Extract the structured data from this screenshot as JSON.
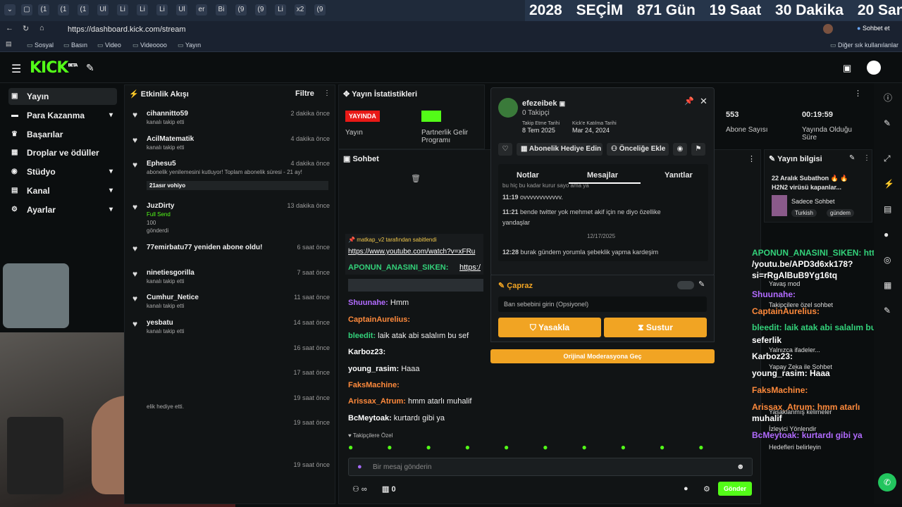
{
  "browser": {
    "url": "https://dashboard.kick.com/stream",
    "tab_labels": [
      "(1",
      "(1",
      "(1",
      "Ul",
      "Li",
      "Li",
      "Li",
      "Ul",
      "er",
      "Bi",
      "(9",
      "(9",
      "Li",
      "x2",
      "(9"
    ],
    "countdown": {
      "year": "2028",
      "election": "SEÇİM",
      "days": "871 Gün",
      "hours": "19 Saat",
      "minutes": "30 Dakika",
      "seconds": "20 Saniye"
    },
    "chat_button": "Sohbet et",
    "bookmarks": [
      "Sosyal",
      "Basın",
      "Video",
      "Videoooo",
      "Yayın"
    ],
    "other_bookmarks": "Diğer sık kullanılanlar"
  },
  "logo": "KICK",
  "logo_sup": "BETA",
  "sidebar": {
    "items": [
      {
        "label": "Yayın",
        "icon": "video-icon"
      },
      {
        "label": "Para Kazanma",
        "icon": "money-icon"
      },
      {
        "label": "Başarılar",
        "icon": "trophy-icon"
      },
      {
        "label": "Droplar ve ödüller",
        "icon": "gift-icon"
      },
      {
        "label": "Stüdyo",
        "icon": "studio-icon"
      },
      {
        "label": "Kanal",
        "icon": "channel-icon"
      },
      {
        "label": "Ayarlar",
        "icon": "gear-icon"
      }
    ]
  },
  "activity": {
    "title": "Etkinlik Akışı",
    "filter": "Filtre",
    "items": [
      {
        "name": "cihannitto59",
        "sub": "kanalı takip etti",
        "time": "2 dakika önce"
      },
      {
        "name": "AcilMatematik",
        "sub": "kanalı takip etti",
        "time": "4 dakika önce"
      },
      {
        "name": "Ephesu5",
        "sub": "abonelik yenilemesini kutluyor! Toplam abonelik süresi - 21 ay!",
        "time": "4 dakika önce",
        "extra": "21asır vohiyo"
      },
      {
        "name": "JuzDirty",
        "sub": "Full Send",
        "sub2": "100",
        "sub3": "gönderdi",
        "time": "13 dakika önce"
      },
      {
        "name": "77emirbatu77 yeniden abone oldu!",
        "sub": "",
        "time": "6 saat önce"
      },
      {
        "name": "ninetiesgorilla",
        "sub": "kanalı takip etti",
        "time": "7 saat önce"
      },
      {
        "name": "Cumhur_Netice",
        "sub": "kanalı takip etti",
        "time": "11 saat önce"
      },
      {
        "name": "yesbatu",
        "sub": "kanalı takip etti",
        "time": "14 saat önce"
      },
      {
        "name": "",
        "sub": "",
        "time": "16 saat önce"
      },
      {
        "name": "",
        "sub": "",
        "time": "17 saat önce"
      },
      {
        "name": "",
        "sub": "elik hediye etti.",
        "time": "19 saat önce"
      },
      {
        "name": "",
        "sub": "",
        "time": "19 saat önce"
      },
      {
        "name": "",
        "sub": "",
        "time": "19 saat önce"
      }
    ]
  },
  "stats": {
    "title": "Yayın İstatistikleri",
    "live_badge": "YAYINDA",
    "live_label": "Yayın",
    "partner_label": "Partnerlik Gelir Programı",
    "subs_value": "553",
    "subs_label": "Abone Sayısı",
    "uptime_value": "00:19:59",
    "uptime_label": "Yayında Olduğu Süre"
  },
  "chat": {
    "title": "Sohbet",
    "pinned_by": "matkap_v2 tarafından sabitlendi",
    "pinned_link": "https://www.youtube.com/watch?v=xFRu",
    "pinned_user": "APONUN_ANASINI_SIKEN:",
    "pinned_user_text": "https:/",
    "messages": [
      {
        "user": "Shuunahe:",
        "text": " Hmm",
        "color": "#b26bff"
      },
      {
        "user": "CaptainAurelius:",
        "text": "",
        "color": "#ff8a3c"
      },
      {
        "user": "bleedit:",
        "text": " laik atak abi salalım bu sef",
        "color": "#33d17a"
      },
      {
        "user": "Karboz23:",
        "text": "",
        "color": "#ffffff"
      },
      {
        "user": "young_rasim:",
        "text": " Haaa",
        "color": "#ffffff"
      },
      {
        "user": "FaksMachine:",
        "text": "",
        "color": "#ff8a3c"
      },
      {
        "user": "Arissax_Atrum:",
        "text": " hmm atarlı muhalif",
        "color": "#ff8a3c"
      },
      {
        "user": "BcMeytoak:",
        "text": " kurtardı gibi ya",
        "color": "#ffffff"
      }
    ],
    "followers_only": "Takipçilere Özel",
    "input_placeholder": "Bir mesaj gönderin",
    "count": "0",
    "send": "Gönder"
  },
  "modal": {
    "username": "efezeibek",
    "followers": "0 Takipçi",
    "follow_date_label": "Takip Etme Tarihi",
    "follow_date": "8 Tem 2025",
    "join_label": "Kick'e Katılma Tarihi",
    "join_date": "Mar 24, 2024",
    "gift_sub": "Abonelik Hediye Edin",
    "priority": "Önceliğe Ekle",
    "tabs": [
      "Notlar",
      "Mesajlar",
      "Yanıtlar"
    ],
    "messages": [
      {
        "time": "11:19",
        "text": "ovvvvvvvvvvvv."
      },
      {
        "time": "11:21",
        "text": "bende twitter yok mehmet akif için ne diyo özellike yandaşlar"
      },
      {
        "time": "12:28",
        "text": "burak gündem yorumla şebeklik yapma kardeşim"
      }
    ],
    "date_sep": "12/17/2025",
    "partial_top": "bu hiç bu kadar kurur sayo ama ya",
    "ban_title": "Çapraz",
    "ban_placeholder": "Ban sebebini girin (Opsiyonel)",
    "ban_button": "Yasakla",
    "timeout_button": "Sustur",
    "orig_mod": "Orijinal Moderasyona Geç"
  },
  "info": {
    "title": "Yayın bilgisi",
    "stream_title": "22 Aralık Subathon 🔥 🔥 H2N2 virüsü kapanlar...",
    "category": "Sadece Sohbet",
    "tags": [
      "Turkish",
      "gündem"
    ]
  },
  "right_overlay": {
    "lines": [
      {
        "text": "APONUN_ANASINI_SIKEN: https:/",
        "color": "#33d17a"
      },
      {
        "text": "/youtu.be/APD3d6xk178?",
        "color": "#ffffff"
      },
      {
        "text": "si=rRgAlBuB9Yg16tq",
        "color": "#ffffff"
      },
      {
        "text": "Shuunahe:",
        "color": "#b26bff"
      },
      {
        "text": "CaptainAurelius:",
        "color": "#ff8a3c"
      },
      {
        "text": "bleedit: laik atak abi salalım bu",
        "color": "#33d17a"
      },
      {
        "text": "seferlik",
        "color": "#ffffff"
      },
      {
        "text": "Karboz23:",
        "color": "#ffffff"
      },
      {
        "text": "young_rasim: Haaa",
        "color": "#ffffff"
      },
      {
        "text": "FaksMachine:",
        "color": "#ff8a3c"
      },
      {
        "text": "Arissax_Atrum: hmm atarlı",
        "color": "#ff8a3c"
      },
      {
        "text": "muhalif",
        "color": "#ffffff"
      },
      {
        "text": "BcMeytoak: kurtardı gibi ya",
        "color": "#b26bff"
      }
    ],
    "settings": [
      "Yavaş mod",
      "Takipçilere özel sohbet",
      "Yalnızca ifadeler...",
      "Yapay Zeka ile Sohbet",
      "Yasaklanmış kelimeler",
      "İzleyici Yönlendir",
      "Hedefleri belirleyin"
    ]
  }
}
